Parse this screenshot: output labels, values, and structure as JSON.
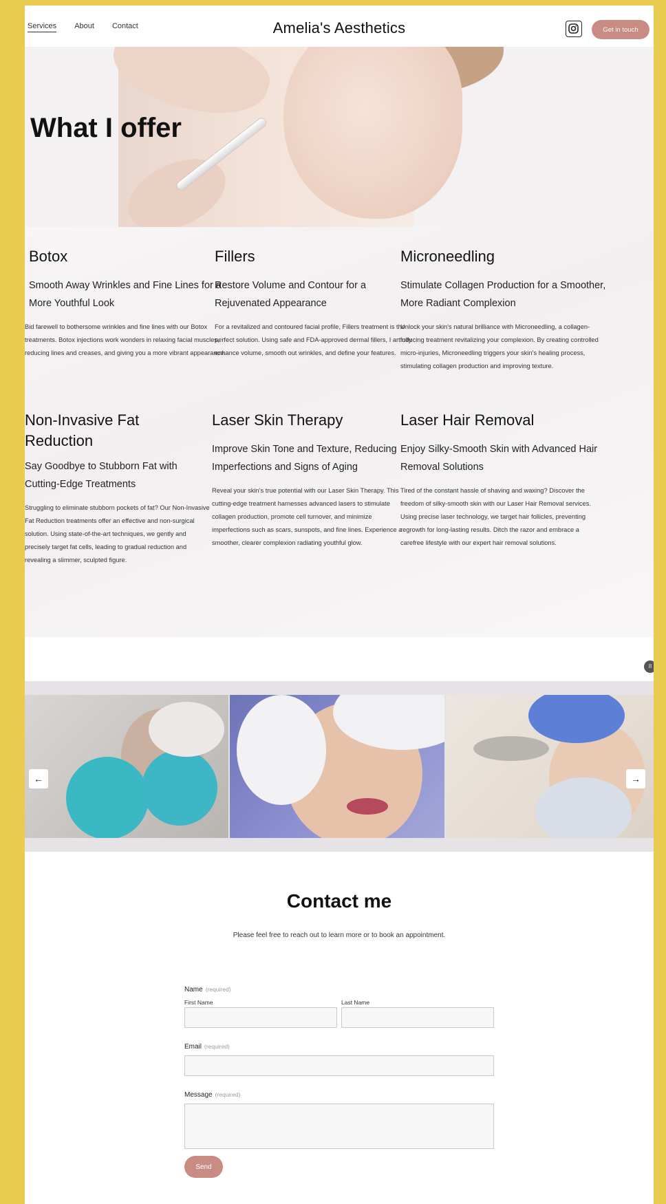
{
  "header": {
    "nav": [
      "Services",
      "About",
      "Contact"
    ],
    "brand": "Amelia's Aesthetics",
    "cta": "Get in touch",
    "social_icon": "instagram-icon"
  },
  "hero": {
    "title": "What I offer"
  },
  "services": [
    {
      "title": "Botox",
      "subtitle": "Smooth Away Wrinkles and Fine Lines for a More Youthful Look",
      "description": "Bid farewell to bothersome wrinkles and fine lines with our Botox treatments. Botox injections work wonders in relaxing facial muscles, reducing lines and creases, and giving you a more vibrant appearance."
    },
    {
      "title": "Fillers",
      "subtitle": "Restore Volume and Contour for a Rejuvenated Appearance",
      "description": "For a revitalized and contoured facial profile, Fillers treatment is the perfect solution. Using safe and FDA-approved dermal fillers, I artfully enhance volume, smooth out wrinkles, and define your features."
    },
    {
      "title": "Microneedling",
      "subtitle": "Stimulate Collagen Production for a Smoother, More Radiant Complexion",
      "description": "Unlock your skin's natural brilliance with Microneedling, a collagen-inducing treatment revitalizing your complexion. By creating controlled micro-injuries, Microneedling triggers your skin's healing process, stimulating collagen production and improving texture."
    },
    {
      "title": "Non-Invasive Fat Reduction",
      "subtitle": "Say Goodbye to Stubborn Fat with Cutting-Edge Treatments",
      "description": "Struggling to eliminate stubborn pockets of fat? Our Non-Invasive Fat Reduction treatments offer an effective and non-surgical solution. Using state-of-the-art techniques, we gently and precisely target fat cells, leading to gradual reduction and revealing a slimmer, sculpted figure."
    },
    {
      "title": "Laser Skin Therapy",
      "subtitle": "Improve Skin Tone and Texture, Reducing Imperfections and Signs of Aging",
      "description": "Reveal your skin's true potential with our Laser Skin Therapy. This cutting-edge treatment harnesses advanced lasers to stimulate collagen production, promote cell turnover, and minimize imperfections such as scars, sunspots, and fine lines. Experience a smoother, clearer complexion radiating youthful glow."
    },
    {
      "title": "Laser Hair Removal",
      "subtitle": "Enjoy Silky-Smooth Skin with Advanced Hair Removal Solutions",
      "description": "Tired of the constant hassle of shaving and waxing? Discover the freedom of silky-smooth skin with our Laser Hair Removal services. Using precise laser technology, we target hair follicles, preventing regrowth for long-lasting results. Ditch the razor and embrace a carefree lifestyle with our expert hair removal solutions."
    }
  ],
  "gallery": {
    "prev": "←",
    "next": "→",
    "pause": "II"
  },
  "contact": {
    "title": "Contact me",
    "subtitle": "Please feel free to reach out to learn more or to book an appointment.",
    "name_label": "Name",
    "required": "(required)",
    "first_name": "First Name",
    "last_name": "Last Name",
    "email_label": "Email",
    "message_label": "Message",
    "send": "Send"
  },
  "colors": {
    "accent": "#c98c84",
    "frame": "#e9cc4f"
  }
}
